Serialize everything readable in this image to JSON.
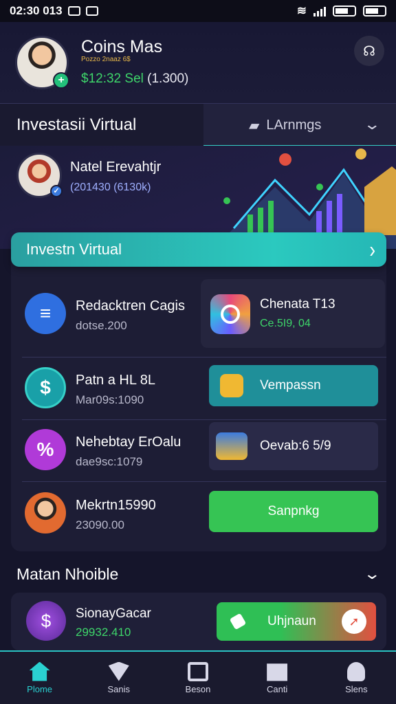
{
  "status_bar": {
    "time": "02:30 013",
    "battery": ""
  },
  "user": {
    "name": "Coins Mas",
    "sub": "Pozzo 2naaz 6$",
    "balance": "$12:32 Sel",
    "balance_extra": "(1.300)"
  },
  "tabs": {
    "active": "Investasii Virtual",
    "other": "LArnmgs"
  },
  "hero": {
    "name": "Natel Erevahtjr",
    "sub": "(201430 (6130k)"
  },
  "banner": {
    "label": "Investn Virtual"
  },
  "list": [
    {
      "title": "Redacktren Cagis",
      "sub": "dotse.200",
      "icon": "chat-icon"
    },
    {
      "title": "Patn a HL 8L",
      "sub": "Mar09s:1090",
      "icon": "dollar-icon"
    },
    {
      "title": "Nehebtay ErOalu",
      "sub": "dae9sc:1079",
      "icon": "percent-icon"
    },
    {
      "title": "Mekrtn15990",
      "sub": "23090.00",
      "icon": "avatar-icon"
    }
  ],
  "tiles": {
    "top": {
      "title": "Chenata T13",
      "sub": "Ce.5I9, 04"
    },
    "cyan_button": "Vempassn",
    "dark_button": "Oevab:6 5/9",
    "green_button": "Sanpnkg"
  },
  "section": {
    "title": "Matan Nhoible"
  },
  "bottom_card": {
    "title": "SionayGacar",
    "sub": "29932.410",
    "button": "Uhjnaun"
  },
  "nav": [
    {
      "label": "Plome",
      "icon": "home-icon"
    },
    {
      "label": "Sanis",
      "icon": "shield-icon"
    },
    {
      "label": "Beson",
      "icon": "box-icon"
    },
    {
      "label": "Canti",
      "icon": "mail-icon"
    },
    {
      "label": "Slens",
      "icon": "user-icon"
    }
  ],
  "colors": {
    "accent": "#2ad1d1",
    "balance_green": "#3ed66a",
    "background": "#15152b"
  }
}
